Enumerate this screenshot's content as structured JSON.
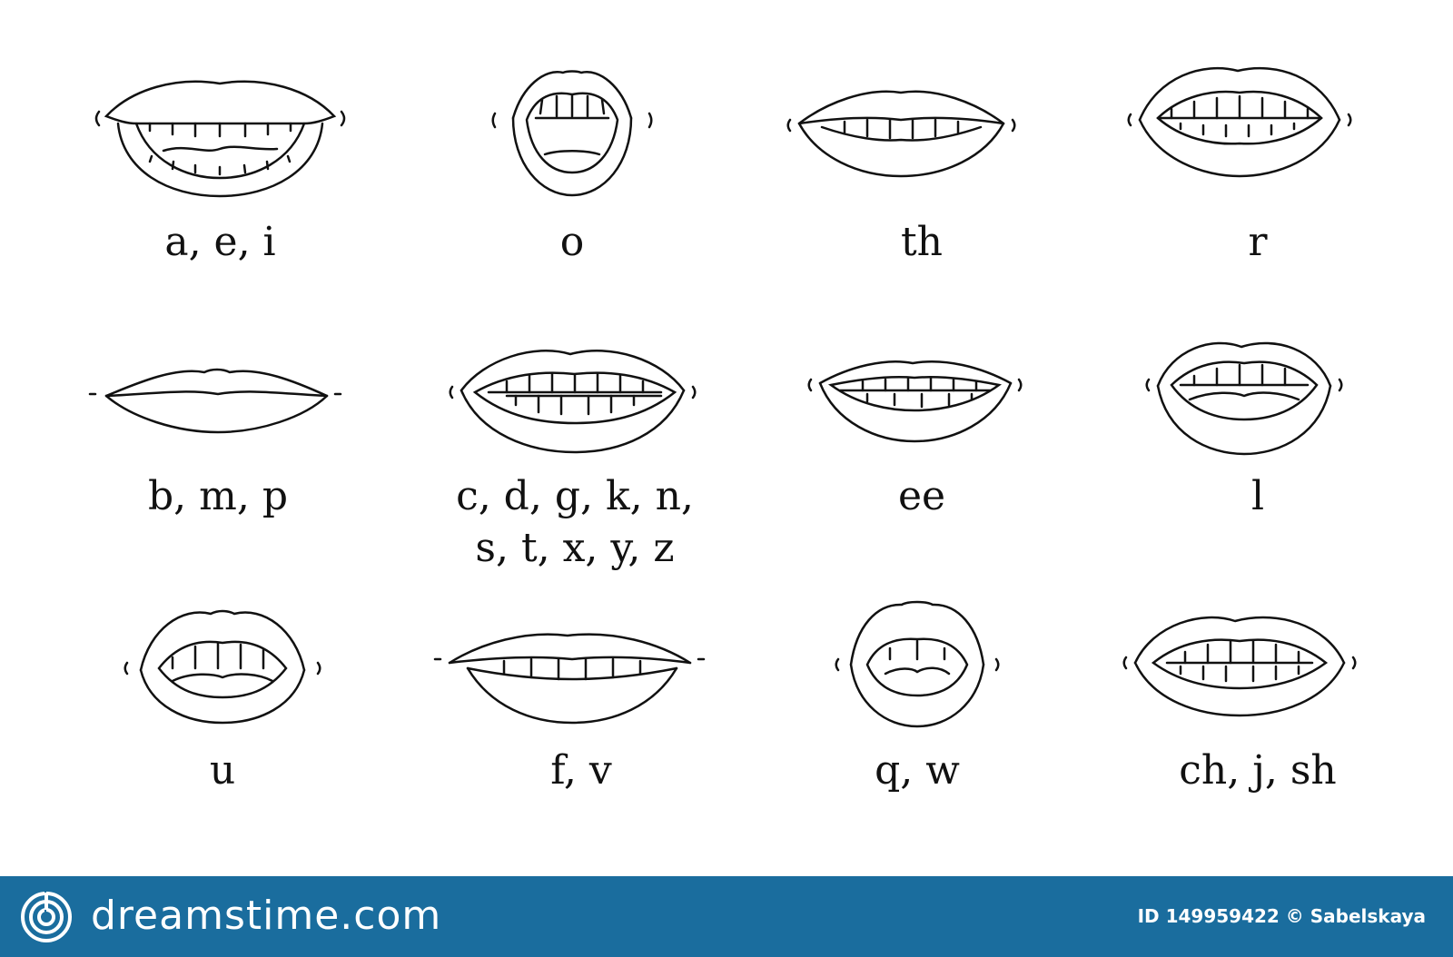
{
  "visemes": [
    {
      "label": "a, e, i",
      "shape": "wide-open"
    },
    {
      "label": "o",
      "shape": "round-open"
    },
    {
      "label": "th",
      "shape": "tongue-between-teeth"
    },
    {
      "label": "r",
      "shape": "teeth-slightly-open"
    },
    {
      "label": "b, m, p",
      "shape": "closed"
    },
    {
      "label": "c, d, g, k, n,",
      "label2": "s, t, x, y, z",
      "shape": "teeth-wide"
    },
    {
      "label": "ee",
      "shape": "teeth-narrow"
    },
    {
      "label": "l",
      "shape": "teeth-tongue"
    },
    {
      "label": "u",
      "shape": "slightly-open"
    },
    {
      "label": "f, v",
      "shape": "lower-lip-teeth"
    },
    {
      "label": "q, w",
      "shape": "pursed"
    },
    {
      "label": "ch, j, sh",
      "shape": "teeth-open"
    }
  ],
  "footer": {
    "brand": "dreamstime.com",
    "credit": "ID 149959422 © Sabelskaya"
  },
  "colors": {
    "footer_bg": "#1a6d9e",
    "line": "#111111"
  }
}
